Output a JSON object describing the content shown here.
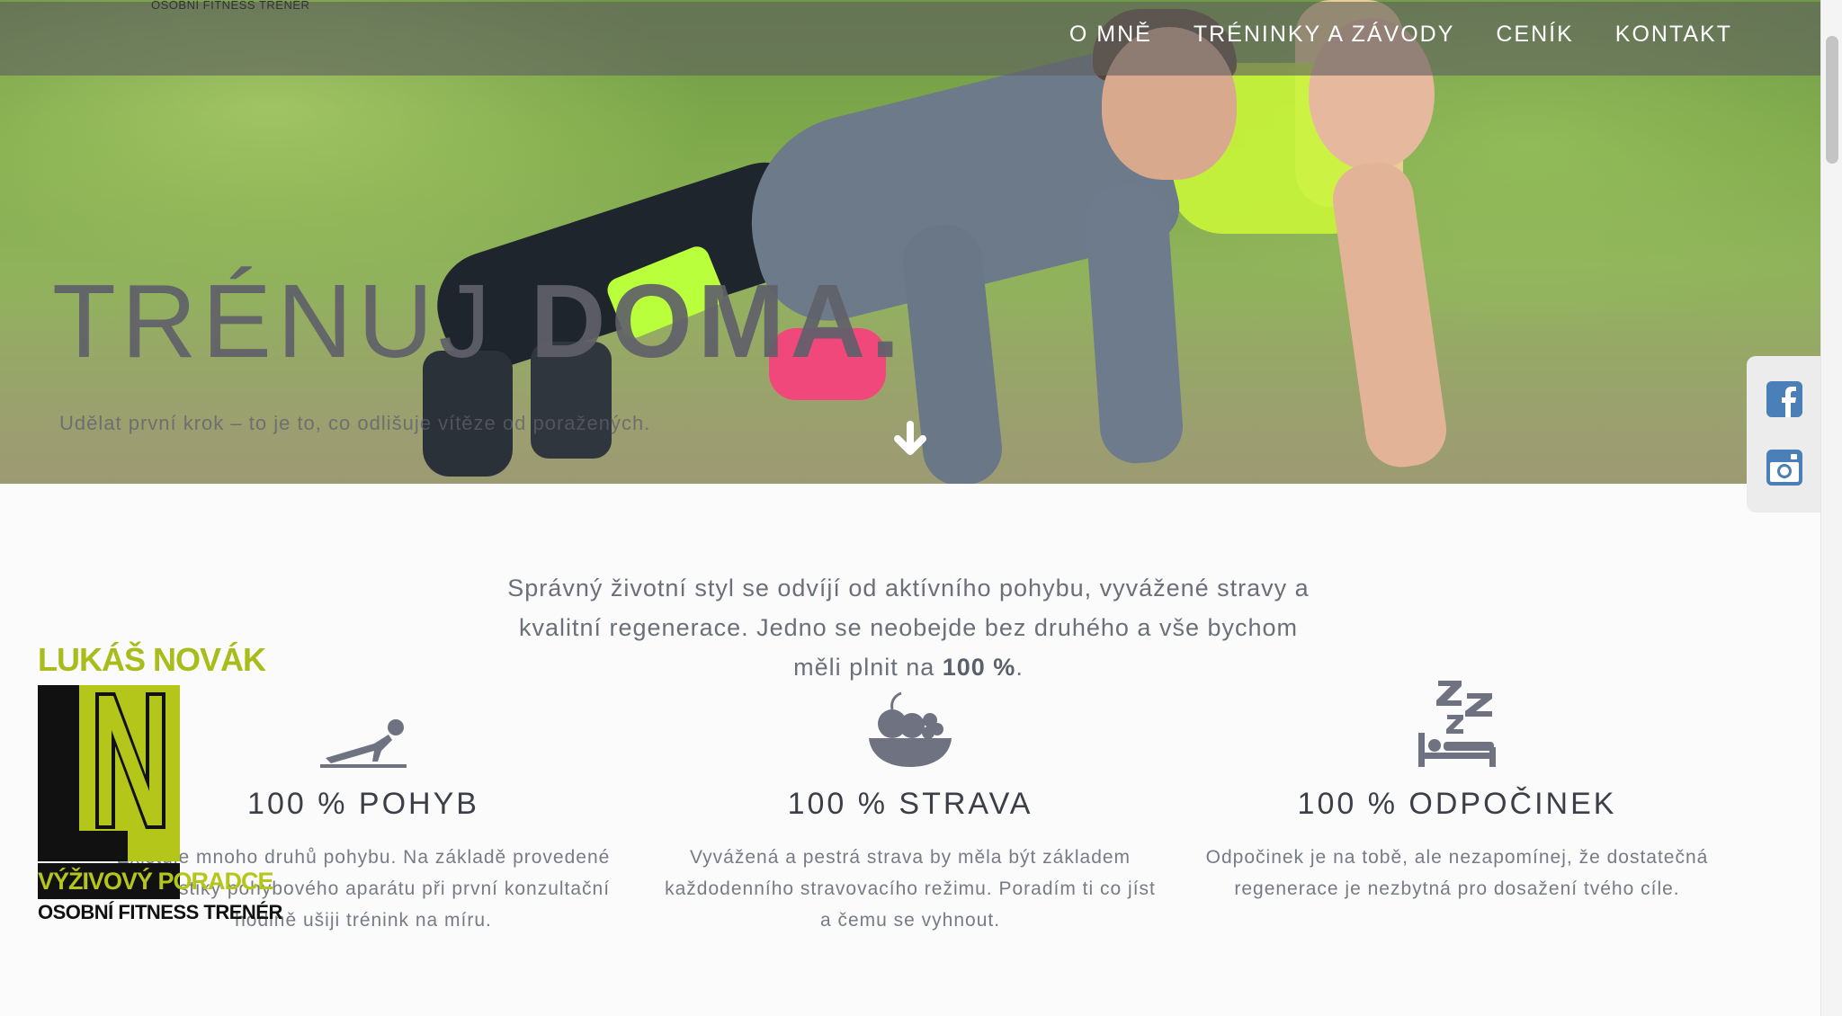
{
  "nav": {
    "logo_text": "OSOBNÍ FITNESS TRENÉR",
    "items": [
      {
        "label": "O MNĚ"
      },
      {
        "label": "TRÉNINKY A ZÁVODY"
      },
      {
        "label": "CENÍK"
      },
      {
        "label": "KONTAKT"
      }
    ]
  },
  "hero": {
    "title_light": "TRÉNUJ",
    "title_bold": "DOMA.",
    "subtitle": "Udělat první krok – to je to, co odlišuje vítěze od poražených.",
    "scroll_icon": "arrow-down-icon"
  },
  "social": {
    "facebook_icon": "facebook-icon",
    "instagram_icon": "instagram-icon"
  },
  "intro": {
    "text_before": "Správný životní styl se odvíjí od aktívního pohybu, vyvážené stravy a kvalitní regenerace. Jedno se neobejde bez druhého a vše bychom měli plnit na ",
    "text_bold": "100 %",
    "text_after": "."
  },
  "features": [
    {
      "icon": "pushup-icon",
      "title": "100 % POHYB",
      "text": "Existuje mnoho druhů pohybu. Na základě provedené diagnostiky pohybového aparátu při první konzultační hodině ušiji trénink na míru."
    },
    {
      "icon": "fruit-bowl-icon",
      "title": "100 % STRAVA",
      "text": "Vyvážená a pestrá strava by měla být základem každodenního stravovacího režimu. Poradím ti co jíst a čemu se vyhnout."
    },
    {
      "icon": "sleep-icon",
      "title": "100 % ODPOČINEK",
      "text": "Odpočinek je na tobě, ale nezapomínej, že dostatečná regenerace je nezbytná pro dosažení tvého cíle."
    }
  ],
  "badge": {
    "name": "LUKÁŠ NOVÁK",
    "line1": "VÝŽIVOVÝ PORADCE",
    "line2": "OSOBNÍ FITNESS TRENÉR",
    "copyright": "©"
  },
  "colors": {
    "accent_green": "#b5c61a",
    "text_gray": "#6b6f7a",
    "social_blue": "#4a7fb7"
  }
}
